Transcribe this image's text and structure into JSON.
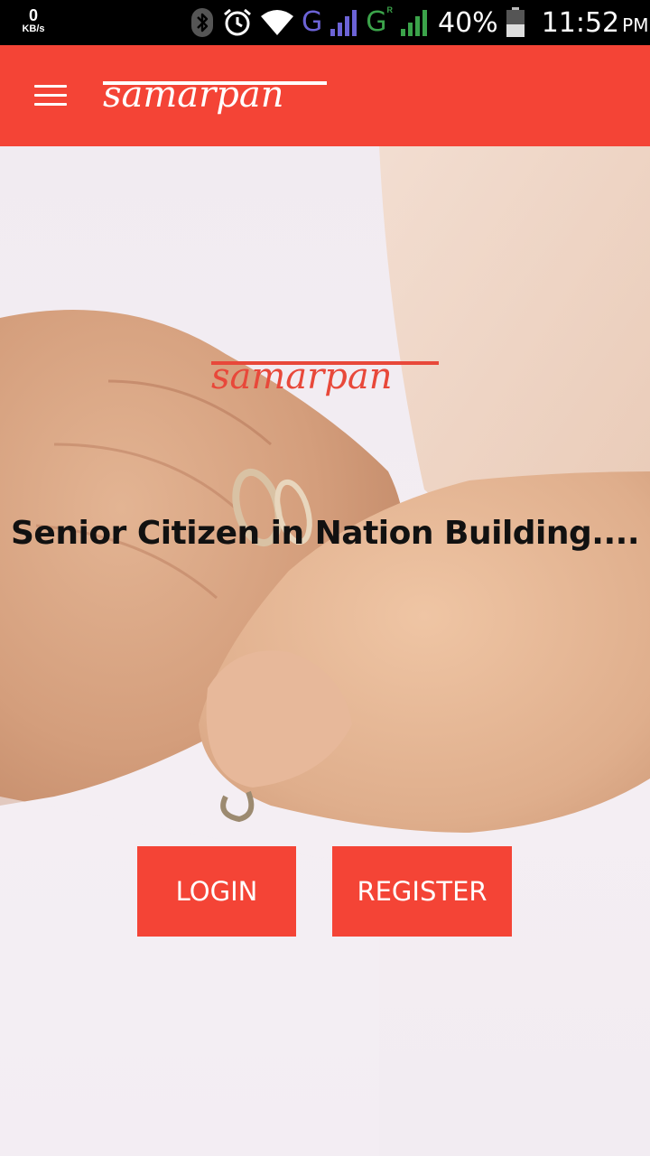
{
  "status_bar": {
    "net_speed_value": "0",
    "net_speed_unit": "KB/s",
    "network1": "G",
    "network2": "G",
    "network2_roaming": "R",
    "battery": "40%",
    "time": "11:52",
    "ampm": "PM"
  },
  "app_bar": {
    "brand": "samarpan"
  },
  "hero": {
    "brand": "samarpan",
    "tagline": "Senior Citizen in Nation Building...."
  },
  "actions": {
    "login_label": "LOGIN",
    "register_label": "REGISTER"
  },
  "colors": {
    "primary": "#f44436",
    "status_bar": "#000000"
  }
}
